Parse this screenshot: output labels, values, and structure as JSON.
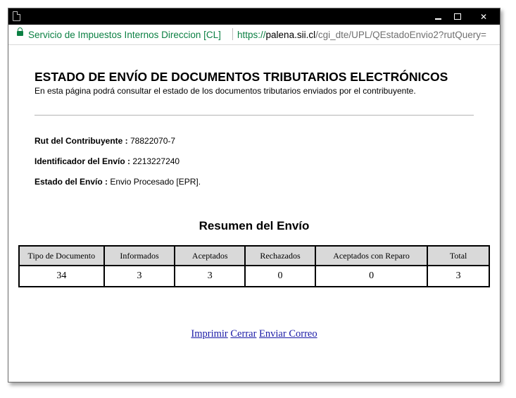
{
  "browser": {
    "org_label": "Servicio de Impuestos Internos Direccion [CL]",
    "url_scheme": "https://",
    "url_host": "palena.sii.cl",
    "url_path": "/cgi_dte/UPL/QEstadoEnvio2?rutQuery=",
    "secure_color": "#0b8043"
  },
  "window": {
    "minimize_icon": "minimize-icon",
    "maximize_icon": "maximize-icon",
    "close_glyph": "✕"
  },
  "page": {
    "title": "ESTADO DE ENVÍO DE DOCUMENTOS TRIBUTARIOS ELECTRÓNICOS",
    "subtitle": "En esta página podrá consultar el estado de los documentos tributarios enviados por el contribuyente.",
    "rut_label": "Rut del Contribuyente :",
    "rut_value": " 78822070-7",
    "envio_label": "Identificador del Envío :",
    "envio_value": " 2213227240",
    "estado_label": "Estado del Envío :",
    "estado_value": " Envio Procesado [EPR].",
    "summary_title": "Resumen del Envío"
  },
  "table": {
    "headers": [
      "Tipo de Documento",
      "Informados",
      "Aceptados",
      "Rechazados",
      "Aceptados con Reparo",
      "Total"
    ],
    "rows": [
      [
        "34",
        "3",
        "3",
        "0",
        "0",
        "3"
      ]
    ]
  },
  "links": {
    "print": "Imprimir",
    "close": "Cerrar",
    "email": "Enviar Correo"
  }
}
